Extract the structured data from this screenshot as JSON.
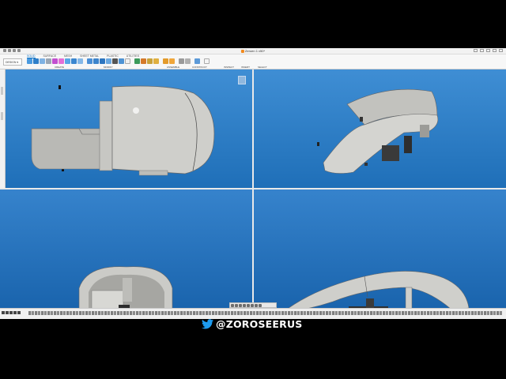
{
  "window": {
    "doc_title": "Zeroen 1 v50*",
    "workspace": "DESIGN"
  },
  "ribbon": {
    "tabs": [
      "SOLID",
      "SURFACE",
      "MESH",
      "SHEET METAL",
      "PLASTIC",
      "UTILITIES"
    ],
    "active_tab": "SOLID",
    "groups": [
      "CREATE",
      "MODIFY",
      "ASSEMBLE",
      "CONSTRUCT",
      "INSPECT",
      "INSERT",
      "SELECT"
    ]
  },
  "browser": {
    "label": "BROWSER"
  },
  "watermark": {
    "handle": "@ZOROSEERUS",
    "icon": "twitter-bird-icon"
  },
  "colors": {
    "viewport_blue": "#2b7bc6",
    "model_grey": "#c8c8c4",
    "accent_orange": "#f28a1e",
    "twitter_blue": "#1d9bf0"
  },
  "viewports": [
    "top-view",
    "perspective-view",
    "front-view",
    "side-view"
  ]
}
